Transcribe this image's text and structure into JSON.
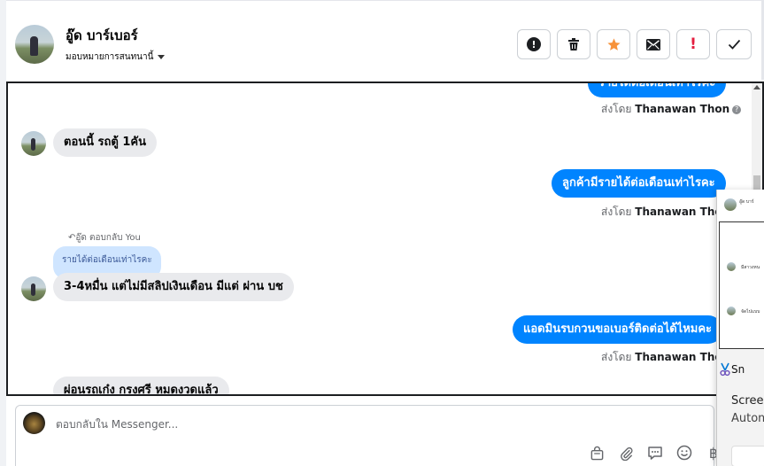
{
  "header": {
    "contact_name": "อู๊ด บาร์เบอร์",
    "assign_label": "มอบหมายการสนทนานี้"
  },
  "toolbar": {
    "spam": "!",
    "urgent": "!"
  },
  "messages": {
    "partial_top": "รายได้ต่อเดือนเท่าไรคะ",
    "sent_by_label": "ส่งโดย",
    "sender_1": "Thanawan Thon",
    "in_1": "ตอนนี้ รถตู้ 1คัน",
    "out_2": "ลูกค้ามีรายได้ต่อเดือนเท่าไรคะ",
    "sender_2": "Thanawan Thon",
    "reply_label": "↶อู๊ด ตอบกลับ You",
    "quoted": "รายได้ต่อเดือนเท่าไรคะ",
    "in_2": "3-4หมื่น แต่ไม่มีสลิปเงินเดือน มีแต่ ผ่าน บช",
    "out_3": "แอดมินรบกวนขอเบอร์ติดต่อได้ไหมคะ",
    "sender_3": "Thanawan Thon",
    "in_3": "ผ่อนรถเก๋ง กรงศรี หมดงวดแล้ว"
  },
  "overlay": {
    "snip_label": "Sn",
    "screen_label": "Screer",
    "auto_label": "Autom",
    "tiny_1": "อู๊ด บาร์",
    "tiny_2": "มอบหมาย",
    "tiny_3": "มีสาวงหน",
    "tiny_4": "จัดไปแบบ"
  },
  "composer": {
    "placeholder": "ตอบกลับใน Messenger..."
  }
}
